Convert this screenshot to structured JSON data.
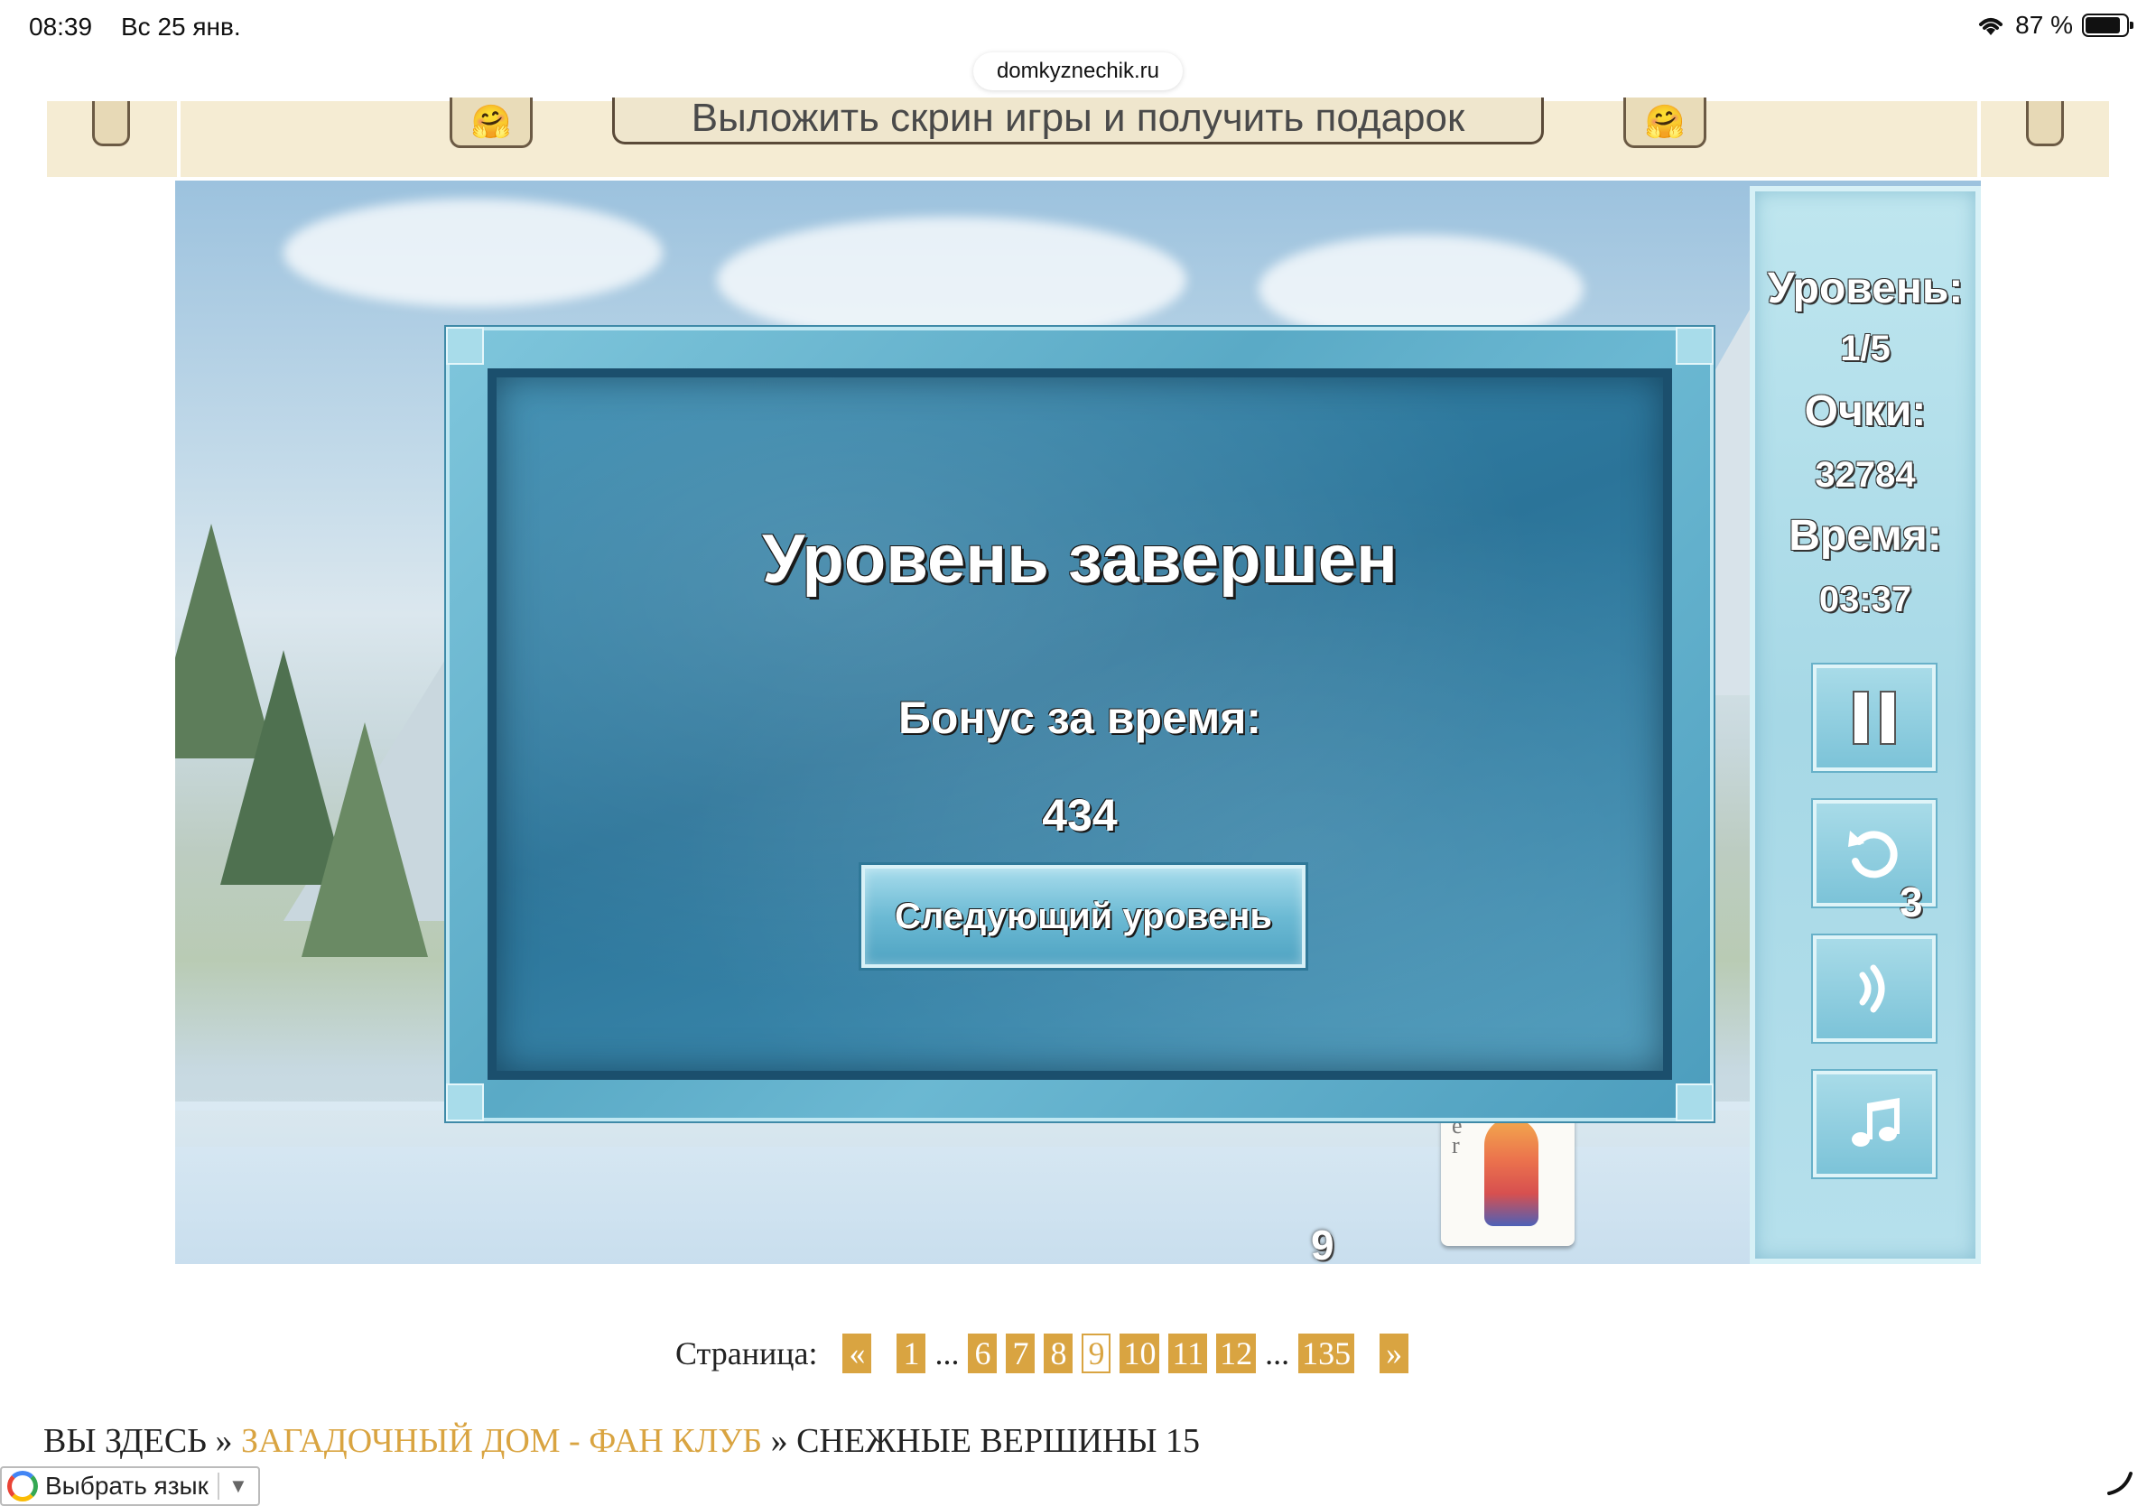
{
  "status_bar": {
    "time": "08:39",
    "date": "Вс 25 янв.",
    "battery": "87 %",
    "battery_level": 0.87
  },
  "url": "domkyznechik.ru",
  "banner": {
    "promo_label": "Выложить скрин игры и получить подарок",
    "emoji": "🤗"
  },
  "game": {
    "deck_count": "9",
    "card_letters": [
      "e",
      "r"
    ]
  },
  "dialog": {
    "title": "Уровень завершен",
    "bonus_label": "Бонус за время:",
    "bonus_value": "434",
    "next_button": "Следующий уровень"
  },
  "panel": {
    "level_label": "Уровень:",
    "level_value": "1/5",
    "score_label": "Очки:",
    "score_value": "32784",
    "time_label": "Время:",
    "time_value": "03:37",
    "undo_count": "3",
    "buttons": [
      "pause-icon",
      "undo-icon",
      "sound-icon",
      "music-icon"
    ]
  },
  "pagination": {
    "label": "Страница:",
    "prev": "«",
    "next": "»",
    "ellipsis": "...",
    "pages": [
      "1",
      "6",
      "7",
      "8",
      "9",
      "10",
      "11",
      "12",
      "135"
    ],
    "current": "9"
  },
  "breadcrumb": {
    "prefix": "ВЫ ЗДЕСЬ",
    "sep": "»",
    "parent": "ЗАГАДОЧНЫЙ ДОМ - ФАН КЛУБ",
    "current": "СНЕЖНЫЕ ВЕРШИНЫ 15"
  },
  "translate": {
    "label": "Выбрать язык",
    "arrow": "▼"
  },
  "colors": {
    "accent_gold": "#d9a441",
    "banner_bg": "#f5ecd3",
    "ice_blue": "#4c9dbd"
  }
}
